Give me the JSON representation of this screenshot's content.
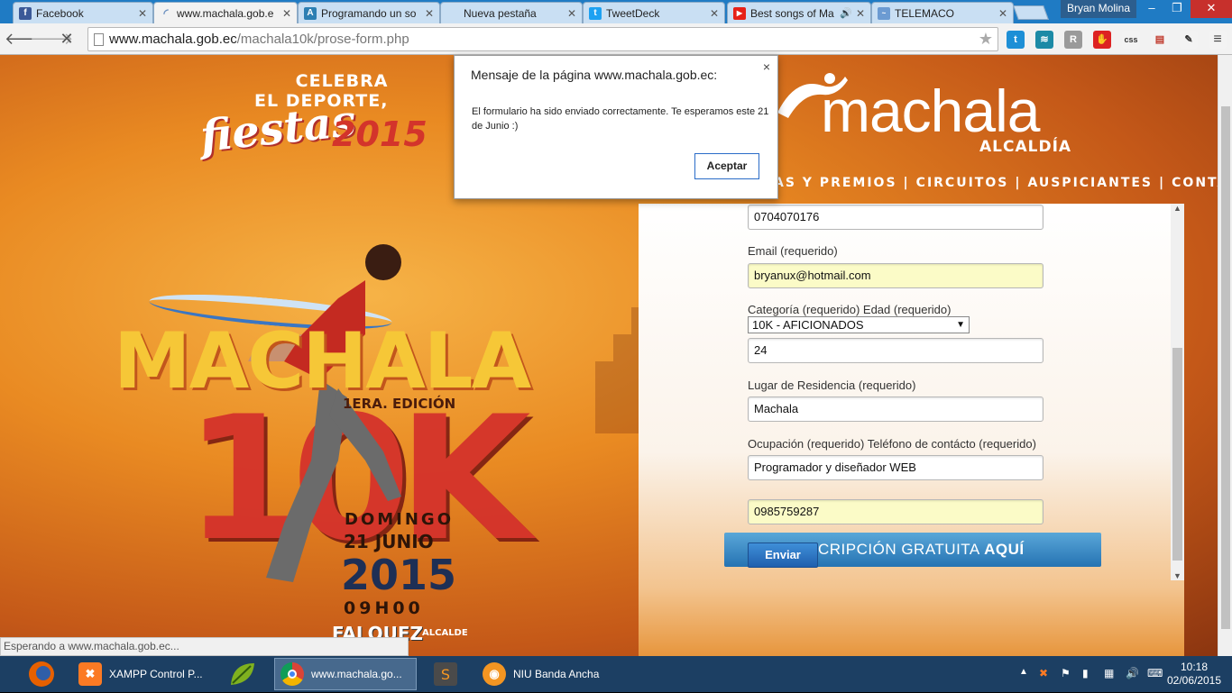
{
  "browser": {
    "tabs": [
      {
        "label": "Facebook",
        "icon": "facebook-icon",
        "color": "#3b5998"
      },
      {
        "label": "www.machala.gob.e",
        "icon": "loading-icon",
        "active": true
      },
      {
        "label": "Programando un so",
        "icon": "a-icon",
        "color": "#2c7fb3"
      },
      {
        "label": "Nueva pestaña",
        "icon": "blank-icon"
      },
      {
        "label": "TweetDeck",
        "icon": "twitter-icon",
        "color": "#1da1f2"
      },
      {
        "label": "Best songs of Ma",
        "icon": "youtube-icon",
        "color": "#e62117"
      },
      {
        "label": "TELEMACO",
        "icon": "telemaco-icon",
        "color": "#6c9bd2"
      }
    ],
    "profile_name": "Bryan Molina",
    "window_controls": {
      "minimize": "–",
      "restore": "❐",
      "close": "✕"
    },
    "url_host": "www.machala.gob.ec",
    "url_path": "/machala10k/prose-form.php",
    "status_text": "Esperando a www.machala.gob.ec..."
  },
  "page": {
    "celebra_line1": "CELEBRA",
    "celebra_line2": "EL DEPORTE,",
    "fiestas": "fiestas",
    "fiestas_year": "2015",
    "logo_text": "machala",
    "logo_sub": "ALCALDÍA",
    "nav": [
      "AS Y PREMIOS",
      "CIRCUITOS",
      "AUSPICIANTES",
      "CONTÁCTOS"
    ],
    "poster": {
      "machala": "MACHALA",
      "edicion": "1ERA. EDICIÓN",
      "tenk": "10K",
      "domingo": "DOMINGO",
      "fecha": "21 JUNIO",
      "anio": "2015",
      "hora": "09H00",
      "alcalde": "FALQUEZ",
      "alcalde_sub": "ALCALDE"
    }
  },
  "form": {
    "cedula_value": "0704070176",
    "email_label": "Email (requerido)",
    "email_value": "bryanux@hotmail.com",
    "categoria_label": "Categoría (requerido) Edad (requerido)",
    "categoria_value": "10K - AFICIONADOS",
    "edad_value": "24",
    "residencia_label": "Lugar de Residencia (requerido)",
    "residencia_value": "Machala",
    "ocupacion_label": "Ocupación (requerido) Teléfono de contácto (requerido)",
    "ocupacion_value": "Programador y diseñador WEB",
    "telefono_value": "0985759287",
    "banner_text": "CRIPCIÓN GRATUITA",
    "banner_bold": "AQUÍ",
    "submit_label": "Enviar"
  },
  "dialog": {
    "title": "Mensaje de la página www.machala.gob.ec:",
    "message": "El formulario ha sido enviado correctamente. Te esperamos este 21 de Junio :)",
    "ok_label": "Aceptar",
    "close": "×"
  },
  "taskbar": {
    "apps": [
      {
        "label": "XAMPP Control P...",
        "color": "#fb7a24"
      },
      {
        "label": "www.machala.go...",
        "color": "#e8412d",
        "active": true
      },
      {
        "label": "NIU Banda Ancha",
        "color": "#f39522"
      }
    ],
    "time": "10:18",
    "date": "02/06/2015"
  }
}
